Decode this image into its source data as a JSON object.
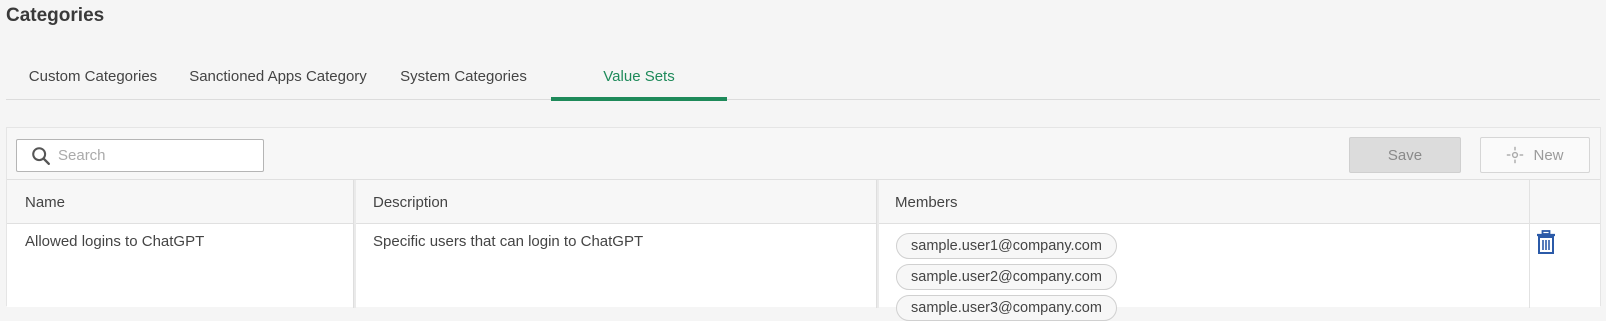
{
  "page": {
    "title": "Categories"
  },
  "tabs": [
    {
      "label": "Custom Categories",
      "active": false
    },
    {
      "label": "Sanctioned Apps Category",
      "active": false
    },
    {
      "label": "System Categories",
      "active": false
    },
    {
      "label": "Value Sets",
      "active": true
    }
  ],
  "toolbar": {
    "search_placeholder": "Search",
    "search_value": "",
    "save_label": "Save",
    "new_label": "New"
  },
  "table": {
    "columns": [
      "Name",
      "Description",
      "Members"
    ],
    "rows": [
      {
        "name": "Allowed logins to ChatGPT",
        "description": "Specific users that can login to ChatGPT",
        "members": [
          "sample.user1@company.com",
          "sample.user2@company.com",
          "sample.user3@company.com"
        ]
      }
    ]
  },
  "colors": {
    "accent": "#1e8a5a",
    "trash_icon": "#2b5aa8"
  }
}
